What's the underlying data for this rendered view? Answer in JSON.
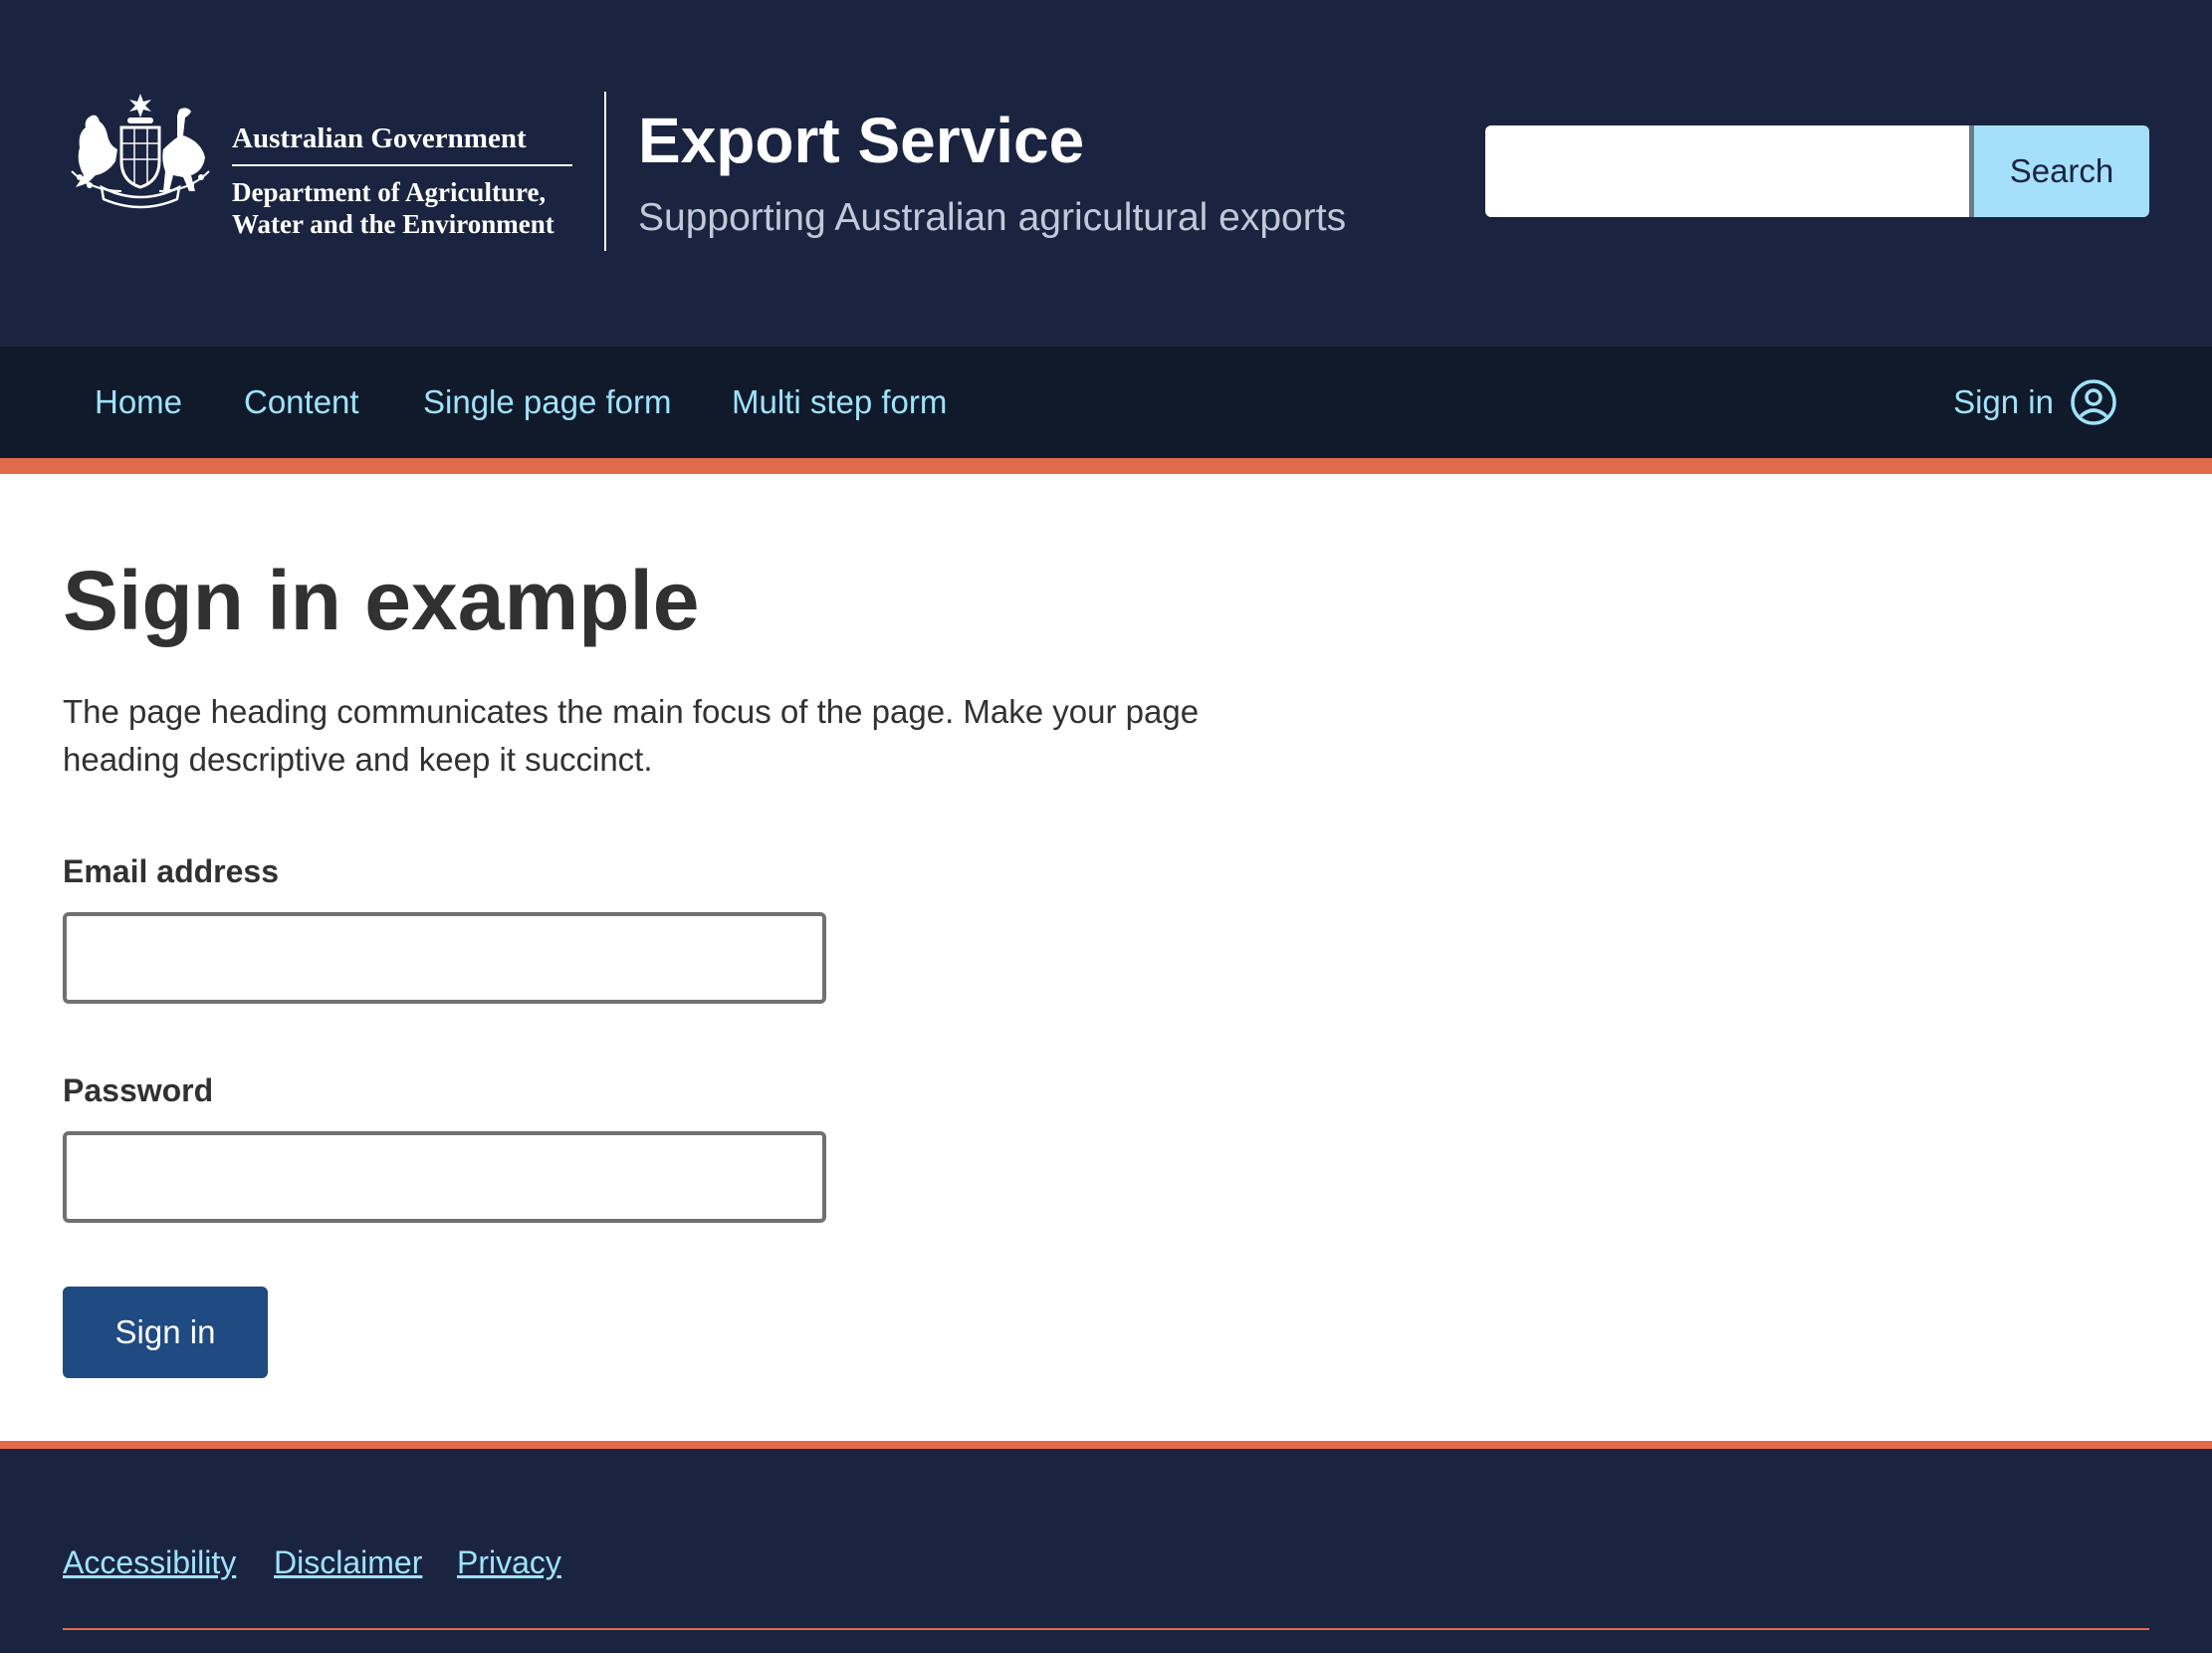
{
  "header": {
    "gov_line1": "Australian Government",
    "gov_line2": "Department of Agriculture,",
    "gov_line3": "Water and the Environment",
    "site_title": "Export Service",
    "site_subtitle": "Supporting Australian agricultural exports",
    "search": {
      "value": "",
      "placeholder": "",
      "button_label": "Search"
    }
  },
  "nav": {
    "items": [
      {
        "label": "Home"
      },
      {
        "label": "Content"
      },
      {
        "label": "Single page form"
      },
      {
        "label": "Multi step form"
      }
    ],
    "signin_label": "Sign in"
  },
  "main": {
    "title": "Sign in example",
    "intro": "The page heading communicates the main focus of the page. Make your page heading descriptive and keep it succinct.",
    "email": {
      "label": "Email address",
      "value": ""
    },
    "password": {
      "label": "Password",
      "value": ""
    },
    "submit_label": "Sign in"
  },
  "footer": {
    "links": [
      {
        "label": "Accessibility"
      },
      {
        "label": "Disclaimer"
      },
      {
        "label": "Privacy"
      }
    ]
  },
  "colors": {
    "header_bg": "#1a2440",
    "nav_bg": "#101a2b",
    "accent": "#e26a4c",
    "link": "#9fe3fc",
    "search_button": "#a5e0fb",
    "primary_button": "#1f4a82",
    "text": "#313131"
  },
  "icons": {
    "logo": "coat-of-arms-icon",
    "signin": "user-circle-icon"
  }
}
